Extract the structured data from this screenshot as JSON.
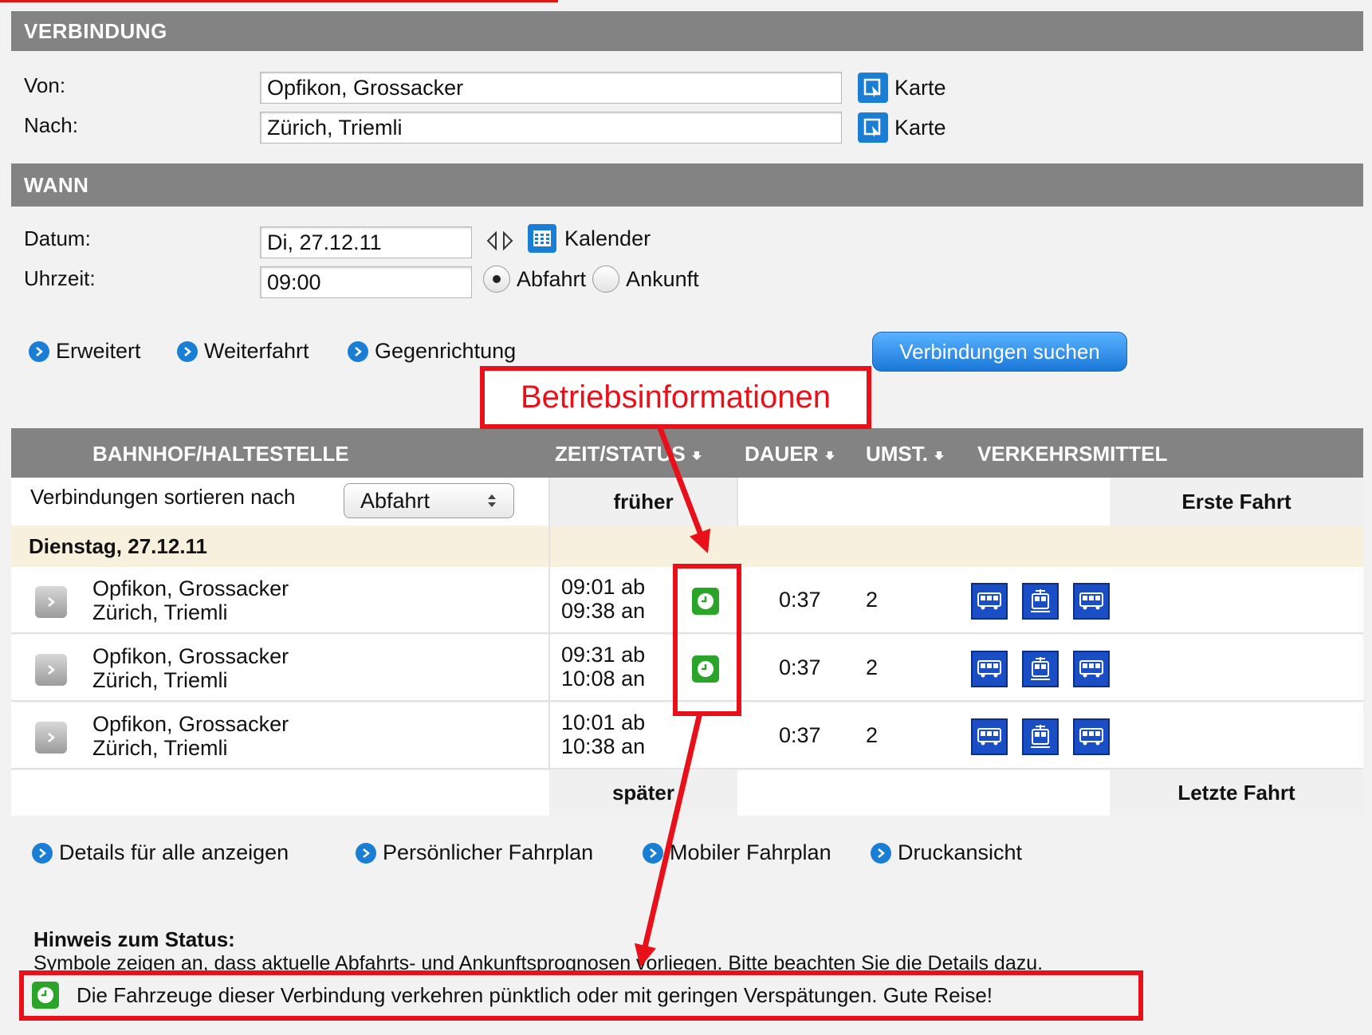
{
  "verbindung": {
    "title": "VERBINDUNG",
    "von_label": "Von:",
    "von_value": "Opfikon, Grossacker",
    "nach_label": "Nach:",
    "nach_value": "Zürich, Triemli",
    "map_label": "Karte"
  },
  "wann": {
    "title": "WANN",
    "datum_label": "Datum:",
    "datum_value": "Di, 27.12.11",
    "kalender_label": "Kalender",
    "uhrzeit_label": "Uhrzeit:",
    "uhrzeit_value": "09:00",
    "abfahrt_label": "Abfahrt",
    "ankunft_label": "Ankunft",
    "selected": "Abfahrt"
  },
  "options": {
    "erweitert": "Erweitert",
    "weiterfahrt": "Weiterfahrt",
    "gegenrichtung": "Gegenrichtung",
    "search_button": "Verbindungen suchen"
  },
  "annotation": {
    "label": "Betriebsinformationen"
  },
  "table": {
    "headers": {
      "station": "BAHNHOF/HALTESTELLE",
      "zeit": "ZEIT/STATUS",
      "dauer": "DAUER",
      "umst": "UMST.",
      "verkehrsmittel": "VERKEHRSMITTEL"
    },
    "sort_label": "Verbindungen sortieren nach",
    "sort_value": "Abfahrt",
    "earlier": "früher",
    "first": "Erste Fahrt",
    "later": "später",
    "last": "Letzte Fahrt",
    "day": "Dienstag, 27.12.11",
    "rows": [
      {
        "from": "Opfikon, Grossacker",
        "to": "Zürich, Triemli",
        "dep": "09:01 ab",
        "arr": "09:38 an",
        "duration": "0:37",
        "changes": "2",
        "transport": [
          "bus-icon",
          "tram-icon",
          "bus-icon"
        ],
        "status": "on-time"
      },
      {
        "from": "Opfikon, Grossacker",
        "to": "Zürich, Triemli",
        "dep": "09:31 ab",
        "arr": "10:08 an",
        "duration": "0:37",
        "changes": "2",
        "transport": [
          "bus-icon",
          "tram-icon",
          "bus-icon"
        ],
        "status": "on-time"
      },
      {
        "from": "Opfikon, Grossacker",
        "to": "Zürich, Triemli",
        "dep": "10:01 ab",
        "arr": "10:38 an",
        "duration": "0:37",
        "changes": "2",
        "transport": [
          "bus-icon",
          "tram-icon",
          "bus-icon"
        ],
        "status": "none"
      }
    ]
  },
  "footer_links": {
    "details": "Details für alle anzeigen",
    "persoenlich": "Persönlicher Fahrplan",
    "mobil": "Mobiler Fahrplan",
    "druck": "Druckansicht"
  },
  "note": {
    "title": "Hinweis zum Status:",
    "text": "Symbole zeigen an, dass aktuelle Abfahrts- und Ankunftsprognosen vorliegen. Bitte beachten Sie die Details dazu.",
    "legend": "Die Fahrzeuge dieser Verbindung verkehren pünktlich oder mit geringen Verspätungen. Gute Reise!"
  },
  "colors": {
    "header_gray": "#838383",
    "accent_blue": "#1a7fd4",
    "status_green": "#2aa52a",
    "annotation_red": "#e8111a",
    "transport_blue": "#1a4ec4"
  }
}
